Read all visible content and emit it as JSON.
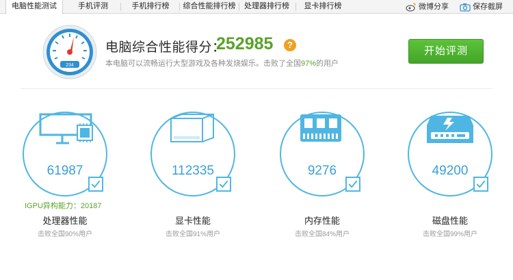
{
  "tabs": [
    {
      "label": "电脑性能测试",
      "active": true
    },
    {
      "label": "手机评测",
      "active": false
    },
    {
      "label": "手机排行榜",
      "active": false
    },
    {
      "label": "综合性能排行榜",
      "active": false
    },
    {
      "label": "处理器排行榜",
      "active": false
    },
    {
      "label": "显卡排行榜",
      "active": false
    }
  ],
  "toolbar": {
    "weibo_share": "微博分享",
    "save_screenshot": "保存截屏"
  },
  "header": {
    "gauge_readout": "234",
    "score_title": "电脑综合性能得分：",
    "score_value": "252985",
    "help_glyph": "?",
    "sub_before": "本电脑可以流畅运行大型游戏及各种发烧娱乐。击败了全国",
    "sub_pct": "97%",
    "sub_after": "的用户",
    "start_button": "开始评测"
  },
  "components": [
    {
      "icon": "monitor-cpu-icon",
      "score": "61987",
      "label": "处理器性能",
      "sub": "击败全国90%用户",
      "extra": "IGPU异构能力：20187"
    },
    {
      "icon": "graphics-card-icon",
      "score": "112335",
      "label": "显卡性能",
      "sub": "击败全国91%用户"
    },
    {
      "icon": "memory-chip-icon",
      "score": "9276",
      "label": "内存性能",
      "sub": "击败全国84%用户"
    },
    {
      "icon": "hard-disk-icon",
      "score": "49200",
      "label": "磁盘性能",
      "sub": "击败全国99%用户"
    }
  ],
  "colors": {
    "accent_blue": "#4fb6e3",
    "score_green": "#58a229",
    "button_green": "#4db330",
    "help_orange": "#f0a020"
  }
}
